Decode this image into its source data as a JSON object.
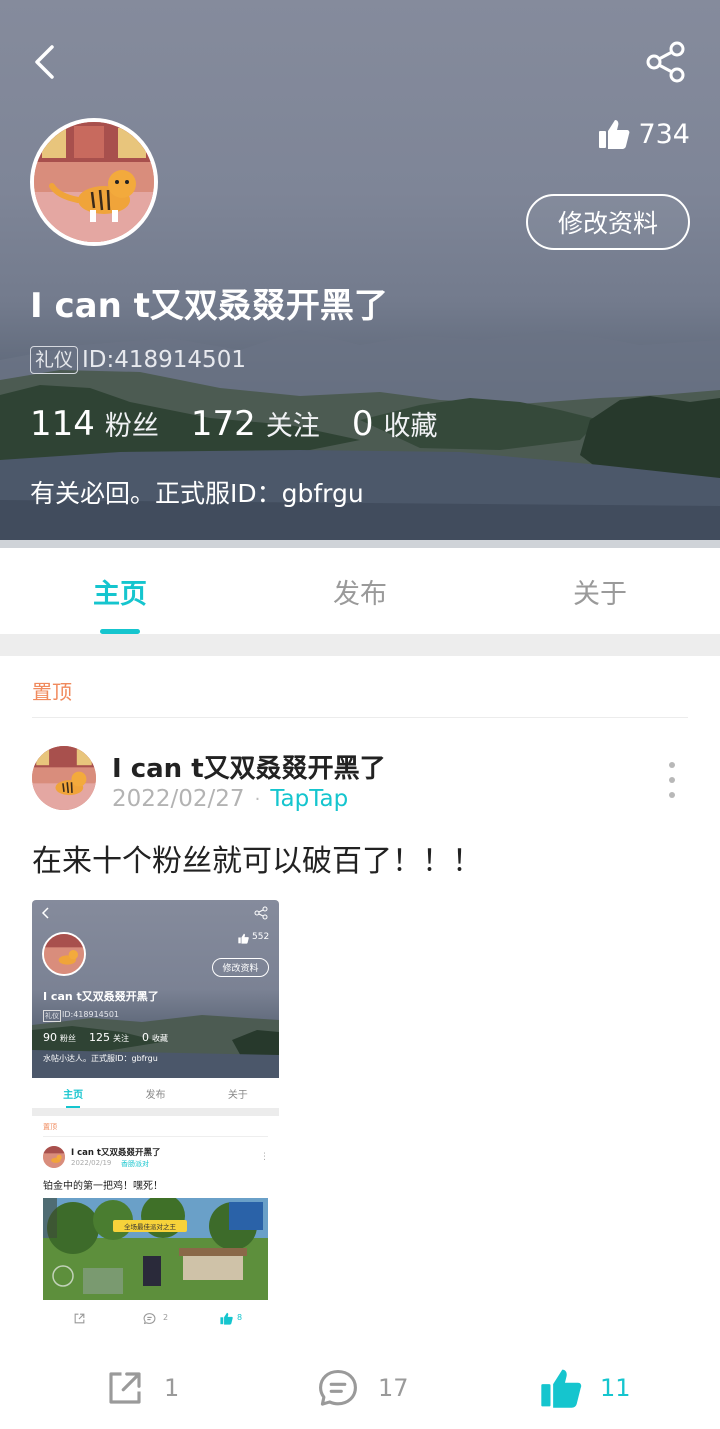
{
  "colors": {
    "accent": "#15c5ce",
    "pinned": "#f08a5d",
    "text": "#222222",
    "muted": "#9a9a9a"
  },
  "header": {
    "icons": {
      "back": "back-arrow-icon",
      "share": "share-icon",
      "like": "thumbs-up-icon"
    },
    "like_count": "734",
    "edit_profile_label": "修改资料",
    "username": "I can t又双叒叕开黑了",
    "id_badge": "礼仪",
    "id_text": "ID:418914501",
    "stats": [
      {
        "value": "114",
        "label": "粉丝"
      },
      {
        "value": "172",
        "label": "关注"
      },
      {
        "value": "0",
        "label": "收藏"
      }
    ],
    "bio": "有关必回。正式服ID：gbfrgu"
  },
  "tabs": [
    {
      "label": "主页",
      "active": true
    },
    {
      "label": "发布",
      "active": false
    },
    {
      "label": "关于",
      "active": false
    }
  ],
  "feed": {
    "pinned_label": "置顶",
    "post": {
      "author": "I can t又双叒叕开黑了",
      "date": "2022/02/27",
      "dot": "·",
      "source": "TapTap",
      "text": "在来十个粉丝就可以破百了！！！",
      "actions": {
        "share_count": "1",
        "comment_count": "17",
        "like_count": "11"
      }
    }
  },
  "embedded_screenshot": {
    "like_count": "552",
    "edit_label": "修改资料",
    "username": "I can t又双叒叕开黑了",
    "id_badge": "礼仪",
    "id_text": "ID:418914501",
    "stats": [
      {
        "value": "90",
        "label": "粉丝"
      },
      {
        "value": "125",
        "label": "关注"
      },
      {
        "value": "0",
        "label": "收藏"
      }
    ],
    "bio": "水帖小达人。正式服ID：gbfrgu",
    "tabs": [
      "主页",
      "发布",
      "关于"
    ],
    "pinned_label": "置顶",
    "post_author": "I can t又双叒叕开黑了",
    "post_date": "2022/02/19",
    "post_source": "香肠派对",
    "post_text": "铂金中的第一把鸡！嘿死！",
    "game_banner": "全场最佳派对之王",
    "comment_count": "2",
    "like_count_post": "8"
  }
}
